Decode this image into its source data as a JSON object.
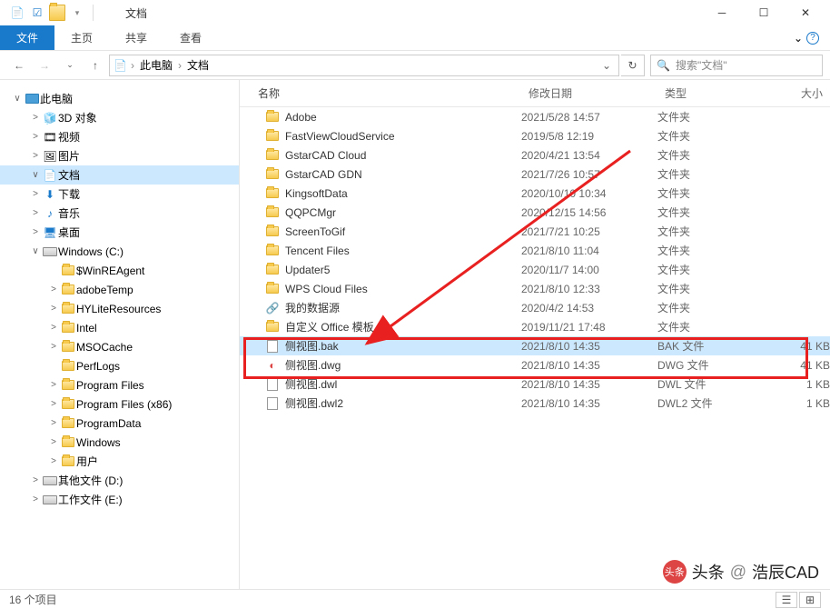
{
  "window": {
    "title": "文档"
  },
  "qat": {
    "dropdown": "▾"
  },
  "ribbon": {
    "file": "文件",
    "tabs": [
      "主页",
      "共享",
      "查看"
    ],
    "help_dd": "⌄"
  },
  "nav": {
    "back": "←",
    "forward": "→",
    "up": "↑",
    "dd": "⌄",
    "refresh": "↻"
  },
  "breadcrumbs": [
    {
      "label": "此电脑"
    },
    {
      "label": "文档"
    }
  ],
  "search": {
    "placeholder": "搜索\"文档\"",
    "icon": "🔍"
  },
  "tree": [
    {
      "type": "item",
      "lvl": 0,
      "exp": "∨",
      "icon": "pc",
      "label": "此电脑",
      "sel": false
    },
    {
      "type": "item",
      "lvl": 1,
      "exp": ">",
      "icon": "3d",
      "label": "3D 对象"
    },
    {
      "type": "item",
      "lvl": 1,
      "exp": ">",
      "icon": "video",
      "label": "视频"
    },
    {
      "type": "item",
      "lvl": 1,
      "exp": ">",
      "icon": "img",
      "label": "图片"
    },
    {
      "type": "item",
      "lvl": 1,
      "exp": "∨",
      "icon": "doc",
      "label": "文档",
      "sel": true
    },
    {
      "type": "item",
      "lvl": 1,
      "exp": ">",
      "icon": "dl",
      "label": "下载"
    },
    {
      "type": "item",
      "lvl": 1,
      "exp": ">",
      "icon": "music",
      "label": "音乐"
    },
    {
      "type": "item",
      "lvl": 1,
      "exp": ">",
      "icon": "desk",
      "label": "桌面"
    },
    {
      "type": "item",
      "lvl": 1,
      "exp": "∨",
      "icon": "drive",
      "label": "Windows (C:)"
    },
    {
      "type": "item",
      "lvl": 2,
      "exp": "",
      "icon": "folder",
      "label": "$WinREAgent"
    },
    {
      "type": "item",
      "lvl": 2,
      "exp": ">",
      "icon": "folder",
      "label": "adobeTemp"
    },
    {
      "type": "item",
      "lvl": 2,
      "exp": ">",
      "icon": "folder",
      "label": "HYLiteResources"
    },
    {
      "type": "item",
      "lvl": 2,
      "exp": ">",
      "icon": "folder",
      "label": "Intel"
    },
    {
      "type": "item",
      "lvl": 2,
      "exp": ">",
      "icon": "folder",
      "label": "MSOCache"
    },
    {
      "type": "item",
      "lvl": 2,
      "exp": "",
      "icon": "folder",
      "label": "PerfLogs"
    },
    {
      "type": "item",
      "lvl": 2,
      "exp": ">",
      "icon": "folder",
      "label": "Program Files"
    },
    {
      "type": "item",
      "lvl": 2,
      "exp": ">",
      "icon": "folder",
      "label": "Program Files (x86)"
    },
    {
      "type": "item",
      "lvl": 2,
      "exp": ">",
      "icon": "folder",
      "label": "ProgramData"
    },
    {
      "type": "item",
      "lvl": 2,
      "exp": ">",
      "icon": "folder",
      "label": "Windows"
    },
    {
      "type": "item",
      "lvl": 2,
      "exp": ">",
      "icon": "folder",
      "label": "用户"
    },
    {
      "type": "item",
      "lvl": 1,
      "exp": ">",
      "icon": "drive",
      "label": "其他文件 (D:)"
    },
    {
      "type": "item",
      "lvl": 1,
      "exp": ">",
      "icon": "drive",
      "label": "工作文件 (E:)"
    }
  ],
  "columns": {
    "name": "名称",
    "date": "修改日期",
    "type": "类型",
    "size": "大小"
  },
  "files": [
    {
      "icon": "folder",
      "name": "Adobe",
      "date": "2021/5/28 14:57",
      "type": "文件夹",
      "size": ""
    },
    {
      "icon": "folder",
      "name": "FastViewCloudService",
      "date": "2019/5/8 12:19",
      "type": "文件夹",
      "size": ""
    },
    {
      "icon": "folder",
      "name": "GstarCAD Cloud",
      "date": "2020/4/21 13:54",
      "type": "文件夹",
      "size": ""
    },
    {
      "icon": "folder",
      "name": "GstarCAD GDN",
      "date": "2021/7/26 10:57",
      "type": "文件夹",
      "size": ""
    },
    {
      "icon": "folder",
      "name": "KingsoftData",
      "date": "2020/10/10 10:34",
      "type": "文件夹",
      "size": ""
    },
    {
      "icon": "folder",
      "name": "QQPCMgr",
      "date": "2020/12/15 14:56",
      "type": "文件夹",
      "size": ""
    },
    {
      "icon": "folder",
      "name": "ScreenToGif",
      "date": "2021/7/21 10:25",
      "type": "文件夹",
      "size": ""
    },
    {
      "icon": "folder",
      "name": "Tencent Files",
      "date": "2021/8/10 11:04",
      "type": "文件夹",
      "size": ""
    },
    {
      "icon": "folder",
      "name": "Updater5",
      "date": "2020/11/7 14:00",
      "type": "文件夹",
      "size": ""
    },
    {
      "icon": "folder",
      "name": "WPS Cloud Files",
      "date": "2021/8/10 12:33",
      "type": "文件夹",
      "size": ""
    },
    {
      "icon": "db",
      "name": "我的数据源",
      "date": "2020/4/2 14:53",
      "type": "文件夹",
      "size": ""
    },
    {
      "icon": "folder",
      "name": "自定义 Office 模板",
      "date": "2019/11/21 17:48",
      "type": "文件夹",
      "size": ""
    },
    {
      "icon": "file",
      "name": "侧视图.bak",
      "date": "2021/8/10 14:35",
      "type": "BAK 文件",
      "size": "41 KB",
      "sel": true,
      "hl": true
    },
    {
      "icon": "dwg",
      "name": "侧视图.dwg",
      "date": "2021/8/10 14:35",
      "type": "DWG 文件",
      "size": "41 KB",
      "hl": true
    },
    {
      "icon": "file",
      "name": "侧视图.dwl",
      "date": "2021/8/10 14:35",
      "type": "DWL 文件",
      "size": "1 KB"
    },
    {
      "icon": "file",
      "name": "侧视图.dwl2",
      "date": "2021/8/10 14:35",
      "type": "DWL2 文件",
      "size": "1 KB"
    }
  ],
  "status": {
    "count": "16 个项目"
  },
  "watermark": {
    "prefix": "头条",
    "at": "@",
    "name": "浩辰CAD",
    "avatar": "头条"
  }
}
